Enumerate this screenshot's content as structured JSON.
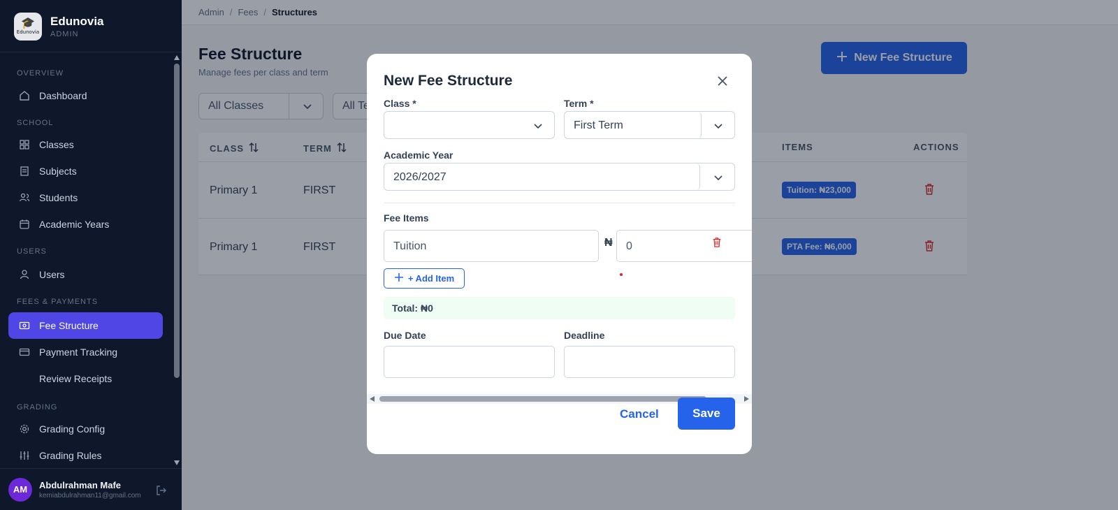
{
  "brand": {
    "name": "Edunovia",
    "role": "ADMIN",
    "logo_text": "Edunovia"
  },
  "sidebar": {
    "sections": [
      {
        "label": "OVERVIEW"
      },
      {
        "label": "SCHOOL"
      },
      {
        "label": "USERS"
      },
      {
        "label": "FEES & PAYMENTS"
      },
      {
        "label": "GRADING"
      }
    ],
    "items": [
      {
        "label": "Dashboard",
        "icon": "home-icon"
      },
      {
        "label": "Classes",
        "icon": "grid-icon"
      },
      {
        "label": "Subjects",
        "icon": "book-icon"
      },
      {
        "label": "Students",
        "icon": "users-icon"
      },
      {
        "label": "Academic Years",
        "icon": "calendar-icon"
      },
      {
        "label": "Users",
        "icon": "user-icon"
      },
      {
        "label": "Fee Structure",
        "icon": "banknote-icon",
        "active": true
      },
      {
        "label": "Payment Tracking",
        "icon": "card-icon"
      },
      {
        "label": "Review Receipts"
      },
      {
        "label": "Grading Config",
        "icon": "gear-icon"
      },
      {
        "label": "Grading Rules",
        "icon": "sliders-icon"
      }
    ]
  },
  "user": {
    "initials": "AM",
    "name": "Abdulrahman Mafe",
    "email": "kemiabdulrahman11@gmail.com"
  },
  "breadcrumb": {
    "items": [
      "Admin",
      "Fees",
      "Structures"
    ]
  },
  "page": {
    "title": "Fee Structure",
    "subtitle": "Manage fees per class and term",
    "new_button": "New Fee Structure",
    "filters": {
      "class": "All Classes",
      "term": "All Te"
    }
  },
  "table": {
    "headers": {
      "class": "CLASS",
      "term": "TERM",
      "items": "ITEMS",
      "actions": "ACTIONS"
    },
    "rows": [
      {
        "class": "Primary 1",
        "term": "FIRST",
        "item": "Tuition: ₦23,000"
      },
      {
        "class": "Primary 1",
        "term": "FIRST",
        "item": "PTA Fee: ₦6,000"
      }
    ]
  },
  "modal": {
    "title": "New Fee Structure",
    "class_label": "Class *",
    "class_value": "",
    "term_label": "Term *",
    "term_value": "First Term",
    "year_label": "Academic Year",
    "year_value": "2026/2027",
    "fee_items_label": "Fee Items",
    "fee_item_name": "Tuition",
    "currency": "₦",
    "fee_item_amount": "0",
    "add_item": "+ Add Item",
    "total": "Total: ₦0",
    "due_date_label": "Due Date",
    "deadline_label": "Deadline",
    "cancel": "Cancel",
    "save": "Save"
  },
  "colors": {
    "accent": "#2563eb",
    "sidebar_bg": "#0f172a",
    "active_item": "#4f46e5",
    "danger": "#dc2626"
  }
}
